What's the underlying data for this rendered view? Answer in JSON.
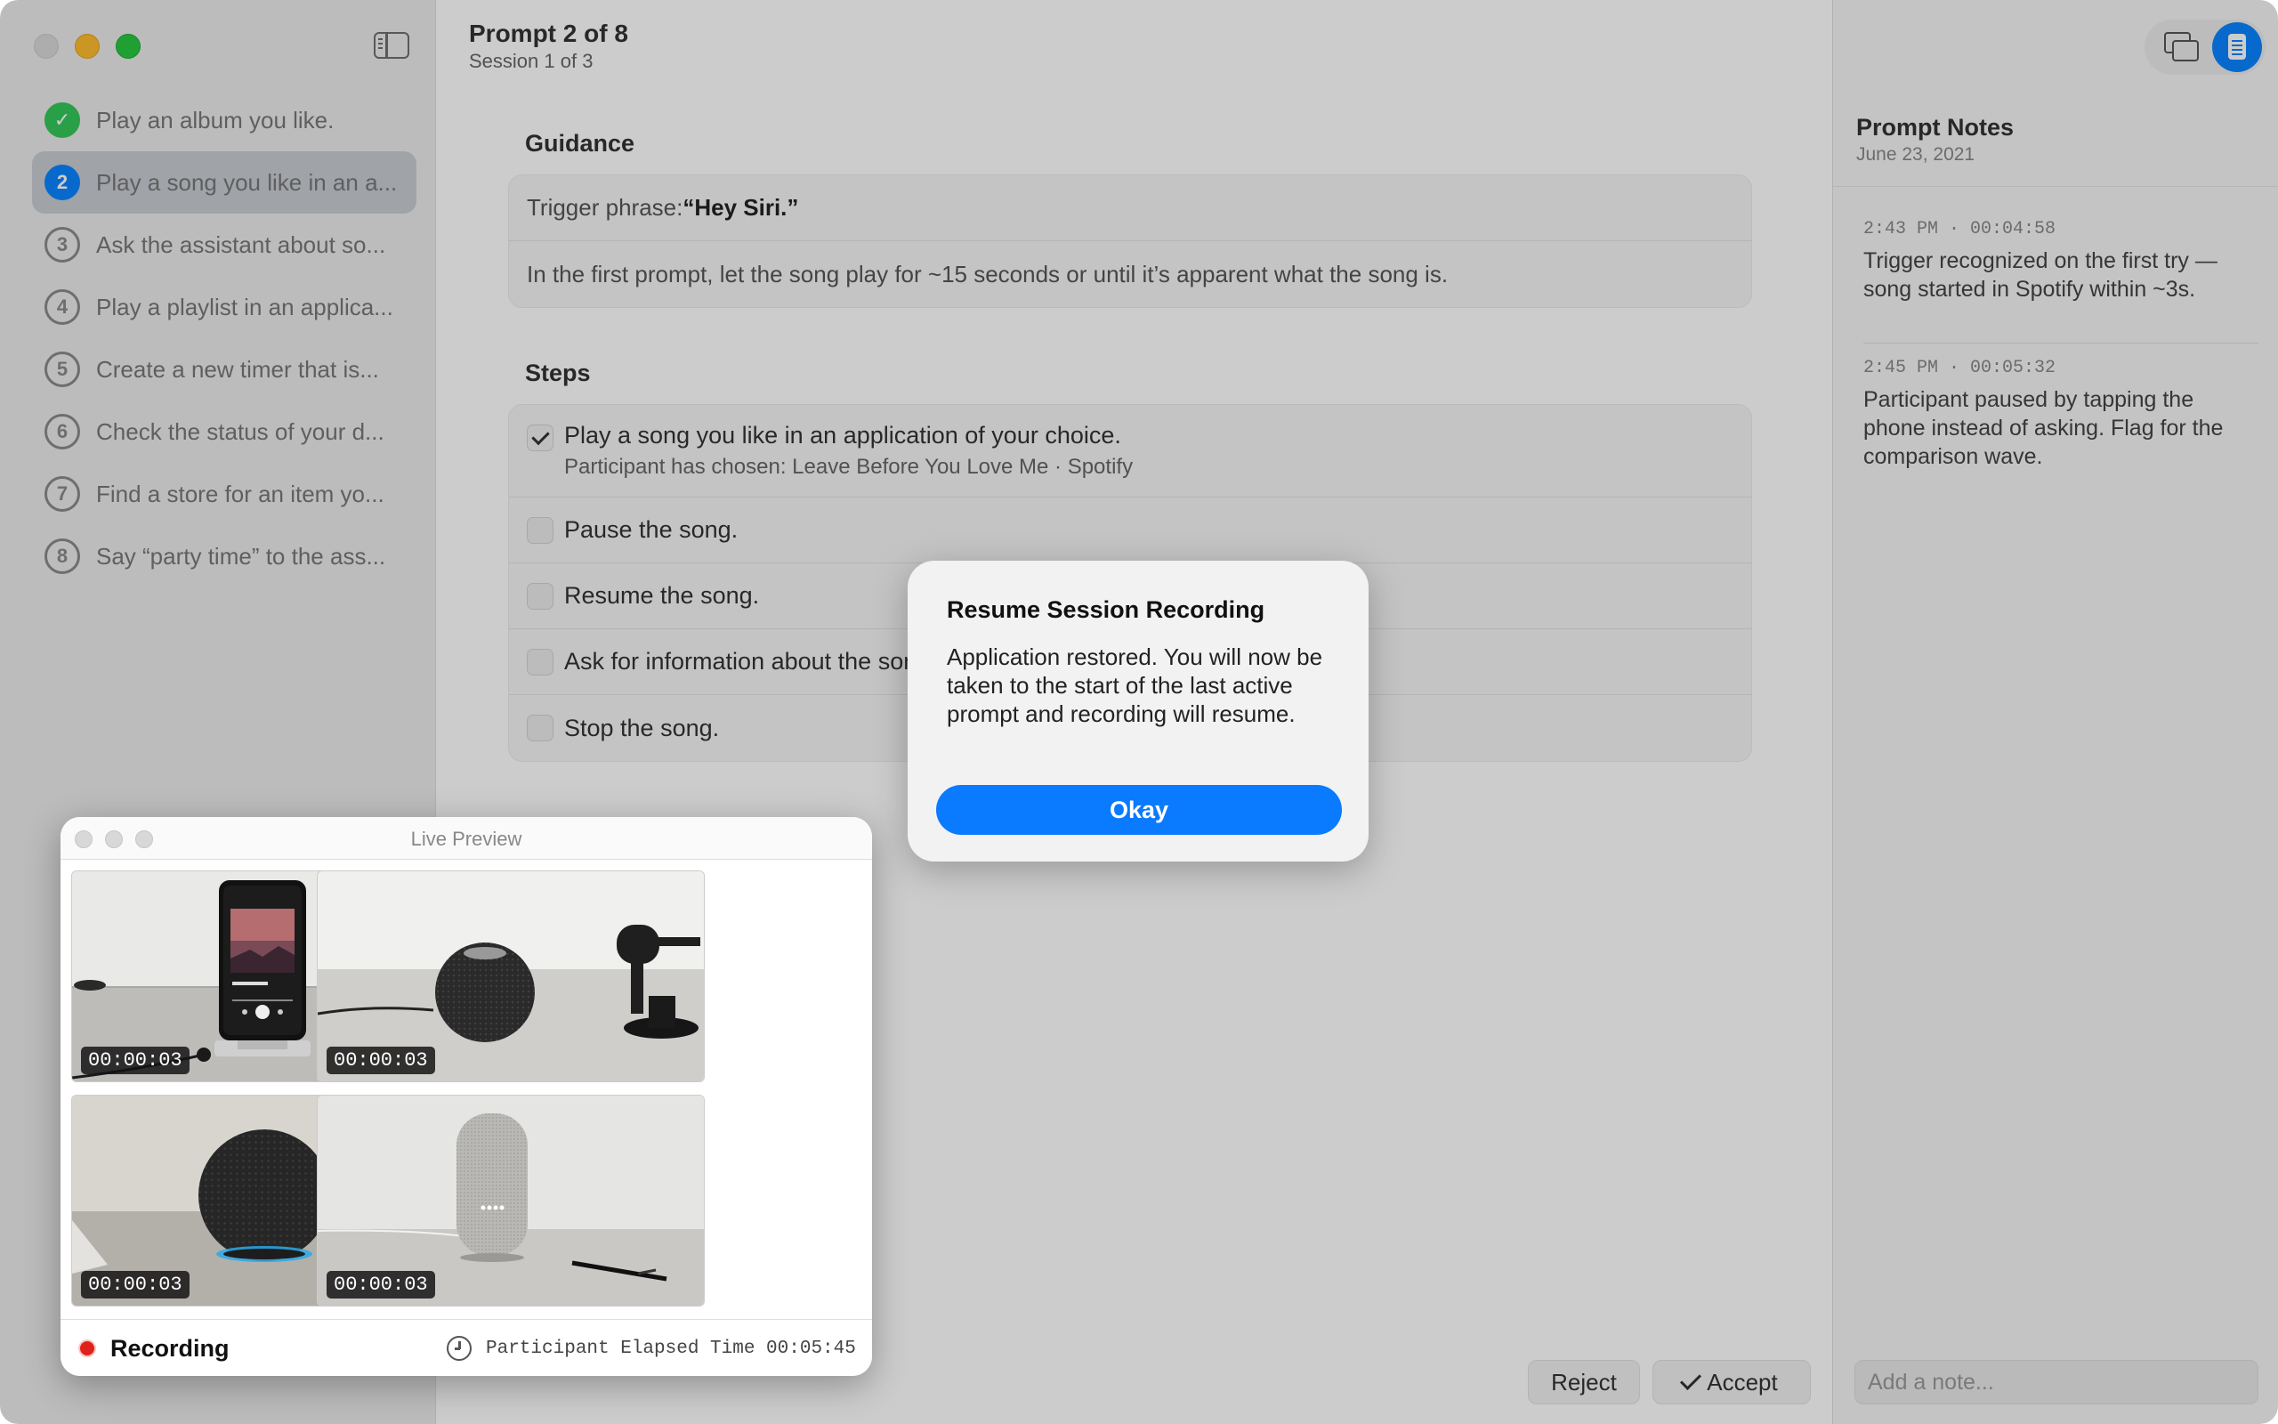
{
  "sidebar": {
    "prompts": [
      {
        "number": "✓",
        "label": "Play an album you like.",
        "status": "done"
      },
      {
        "number": "2",
        "label": "Play a song you like in an a...",
        "status": "active"
      },
      {
        "number": "3",
        "label": "Ask the assistant about so...",
        "status": "pending"
      },
      {
        "number": "4",
        "label": "Play a playlist in an applica...",
        "status": "pending"
      },
      {
        "number": "5",
        "label": "Create a new timer that is...",
        "status": "pending"
      },
      {
        "number": "6",
        "label": "Check the status of your d...",
        "status": "pending"
      },
      {
        "number": "7",
        "label": "Find a store for an item yo...",
        "status": "pending"
      },
      {
        "number": "8",
        "label": "Say “party time” to the ass...",
        "status": "pending"
      }
    ]
  },
  "main": {
    "title": "Prompt 2 of 8",
    "subtitle": "Session 1 of 3",
    "guidance_heading": "Guidance",
    "guidance": {
      "trigger_label": "Trigger phrase: ",
      "trigger_value": "“Hey Siri.”",
      "note": "In the first prompt, let the song play for ~15 seconds or until it’s apparent what the song is."
    },
    "steps_heading": "Steps",
    "steps": [
      {
        "label": "Play a song you like in an application of your choice.",
        "note": "Participant has chosen: Leave Before You Love Me · Spotify",
        "checked": true
      },
      {
        "label": "Pause the song.",
        "checked": false
      },
      {
        "label": "Resume the song.",
        "checked": false
      },
      {
        "label": "Ask for information about the song.",
        "checked": false
      },
      {
        "label": "Stop the song.",
        "checked": false
      }
    ],
    "reject_label": "Reject",
    "accept_label": "Accept"
  },
  "notes": {
    "title": "Prompt Notes",
    "date": "June 23, 2021",
    "entries": [
      {
        "meta": "2:43 PM · 00:04:58",
        "text": "Trigger recognized on the first try — song started in Spotify within ~3s."
      },
      {
        "meta": "2:45 PM · 00:05:32",
        "text": "Participant paused by tapping the phone instead of asking. Flag for the comparison wave."
      }
    ],
    "add_placeholder": "Add a note..."
  },
  "preview": {
    "title": "Live Preview",
    "timestamps": [
      "00:00:03",
      "00:00:03",
      "00:00:03",
      "00:00:03"
    ],
    "recording_label": "Recording",
    "elapsed": "Participant Elapsed Time 00:05:45"
  },
  "dialog": {
    "title": "Resume Session Recording",
    "body": "Application restored. You will now be taken to the start of the last active prompt and recording will resume.",
    "button": "Okay"
  },
  "colors": {
    "accent": "#0a7aff",
    "done": "#34c759",
    "recording": "#e0211b"
  }
}
